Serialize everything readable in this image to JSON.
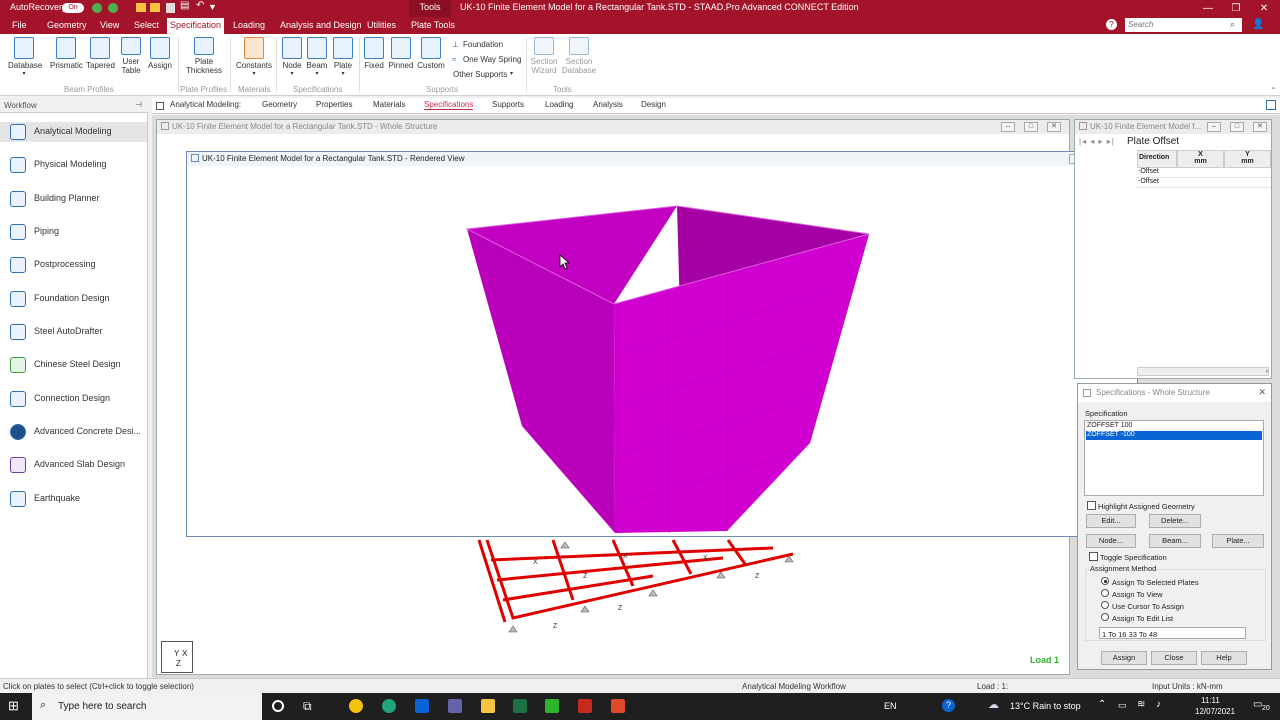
{
  "titlebar": {
    "autorecovery": "AutoRecovery",
    "toggle": "On",
    "contextual_tab": "Tools",
    "title": "UK-10 Finite Element Model for a Rectangular Tank.STD - STAAD.Pro Advanced CONNECT Edition",
    "search_placeholder": "Search"
  },
  "menu": [
    "File",
    "Geometry",
    "View",
    "Select",
    "Specification",
    "Loading",
    "Analysis and Design",
    "Utilities",
    "Plate Tools"
  ],
  "ribbon": {
    "database": "Database",
    "prismatic": "Prismatic",
    "tapered": "Tapered",
    "user_table_1": "User",
    "user_table_2": "Table",
    "assign": "Assign",
    "plate_thickness_1": "Plate",
    "plate_thickness_2": "Thickness",
    "constants": "Constants",
    "node": "Node",
    "beam": "Beam",
    "plate": "Plate",
    "fixed": "Fixed",
    "pinned": "Pinned",
    "custom": "Custom",
    "foundation": "Foundation",
    "one_way_spring": "One Way Spring",
    "other_supports": "Other Supports",
    "section_wizard_1": "Section",
    "section_wizard_2": "Wizard",
    "section_database_1": "Section",
    "section_database_2": "Database",
    "groups": {
      "beam_profiles": "Beam Profiles",
      "plate_profiles": "Plate Profiles",
      "materials": "Materials",
      "specifications": "Specifications",
      "supports": "Supports",
      "tools": "Tools"
    }
  },
  "workflow": {
    "header": "Workflow",
    "items": [
      "Analytical Modeling",
      "Physical Modeling",
      "Building Planner",
      "Piping",
      "Postprocessing",
      "Foundation Design",
      "Steel AutoDrafter",
      "Chinese Steel Design",
      "Connection Design",
      "Advanced Concrete Desi...",
      "Advanced Slab Design",
      "Earthquake"
    ]
  },
  "tabs": {
    "prefix": "Analytical Modeling:",
    "items": [
      "Geometry",
      "Properties",
      "Materials",
      "Specifications",
      "Supports",
      "Loading",
      "Analysis",
      "Design"
    ]
  },
  "windows": {
    "whole": "UK-10 Finite Element Model for a Rectangular Tank.STD - Whole Structure",
    "rendered": "UK-10 Finite Element Model for a Rectangular Tank.STD - Rendered View",
    "table": "UK-10 Finite Element Model f...",
    "load": "Load 1",
    "axis_y": "Y",
    "axis_x": "X",
    "axis_z": "Z"
  },
  "offset_table": {
    "tab": "Plate Offset",
    "cols": [
      "Direction",
      "X",
      "Y"
    ],
    "units": [
      "mm",
      "mm"
    ],
    "rows": [
      "-Offset",
      "-Offset"
    ]
  },
  "spec_dialog": {
    "title": "Specifications - Whole Structure",
    "spec_label": "Specification",
    "list": [
      "ZOFFSET 100",
      "ZOFFSET -100"
    ],
    "highlight": "Highlight Assigned Geometry",
    "edit": "Edit...",
    "delete": "Delete...",
    "node": "Node...",
    "beam": "Beam...",
    "plate": "Plate...",
    "toggle": "Toggle Specification",
    "method_label": "Assignment Method",
    "methods": [
      "Assign To Selected Plates",
      "Assign To View",
      "Use Cursor To Assign",
      "Assign To Edit List"
    ],
    "edit_list_value": "1 To 16 33 To 48",
    "assign": "Assign",
    "close": "Close",
    "help": "Help"
  },
  "status": {
    "hint": "Click on plates to select (Ctrl+click to toggle selection)",
    "workflow": "Analytical Modeling Workflow",
    "load": "Load : 1:",
    "units": "Input Units : kN-mm"
  },
  "taskbar": {
    "search": "Type here to search",
    "lang": "EN",
    "weather": "13°C  Rain to stop",
    "time": "11:11",
    "date": "12/07/2021",
    "badge": "20"
  },
  "colors": {
    "brand": "#a3142a",
    "plate": "#cc00cc"
  }
}
